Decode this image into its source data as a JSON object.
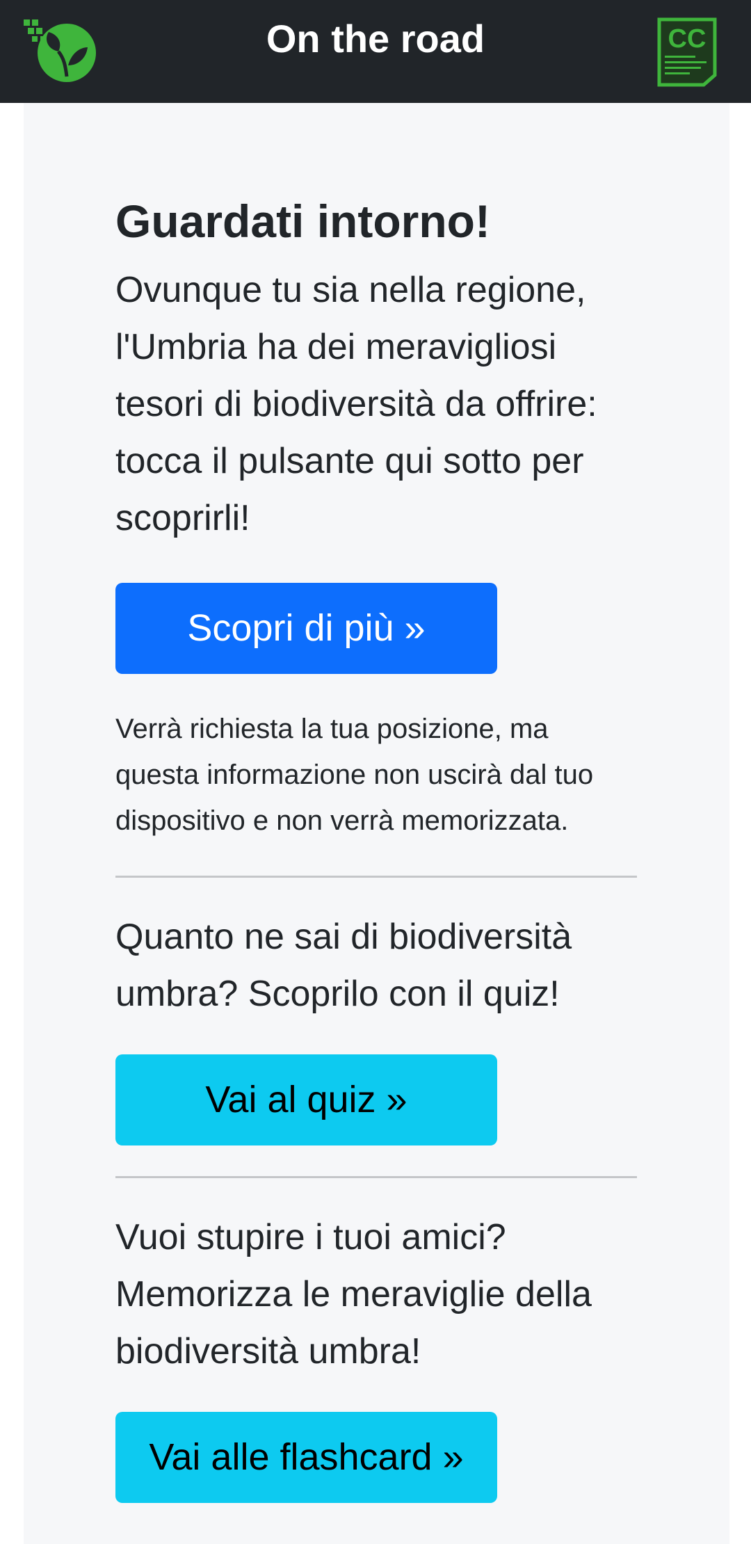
{
  "header": {
    "title": "On the road",
    "logo_icon": "leaf-logo-icon",
    "badge_icon": "cc-badge-icon",
    "badge_text": "CC",
    "brand_color": "#3fb53c"
  },
  "main": {
    "explore": {
      "heading": "Guardati intorno!",
      "text": "Ovunque tu sia nella regione, l'Umbria ha dei meravigliosi tesori di biodiversità da offrire: tocca il pulsante qui sotto per scoprirli!",
      "button_label": "Scopri di più »",
      "note": "Verrà richiesta la tua posizione, ma questa informazione non uscirà dal tuo dispositivo e non verrà memorizzata."
    },
    "quiz": {
      "text": "Quanto ne sai di biodiversità umbra? Scoprilo con il quiz!",
      "button_label": "Vai al quiz »"
    },
    "flashcards": {
      "text": "Vuoi stupire i tuoi amici? Memorizza le meraviglie della biodiversità umbra!",
      "button_label": "Vai alle flashcard »"
    }
  },
  "colors": {
    "navbar_bg": "#212529",
    "primary_button": "#0d6efd",
    "info_button": "#0dcaf0",
    "container_bg": "#f6f7f9"
  }
}
